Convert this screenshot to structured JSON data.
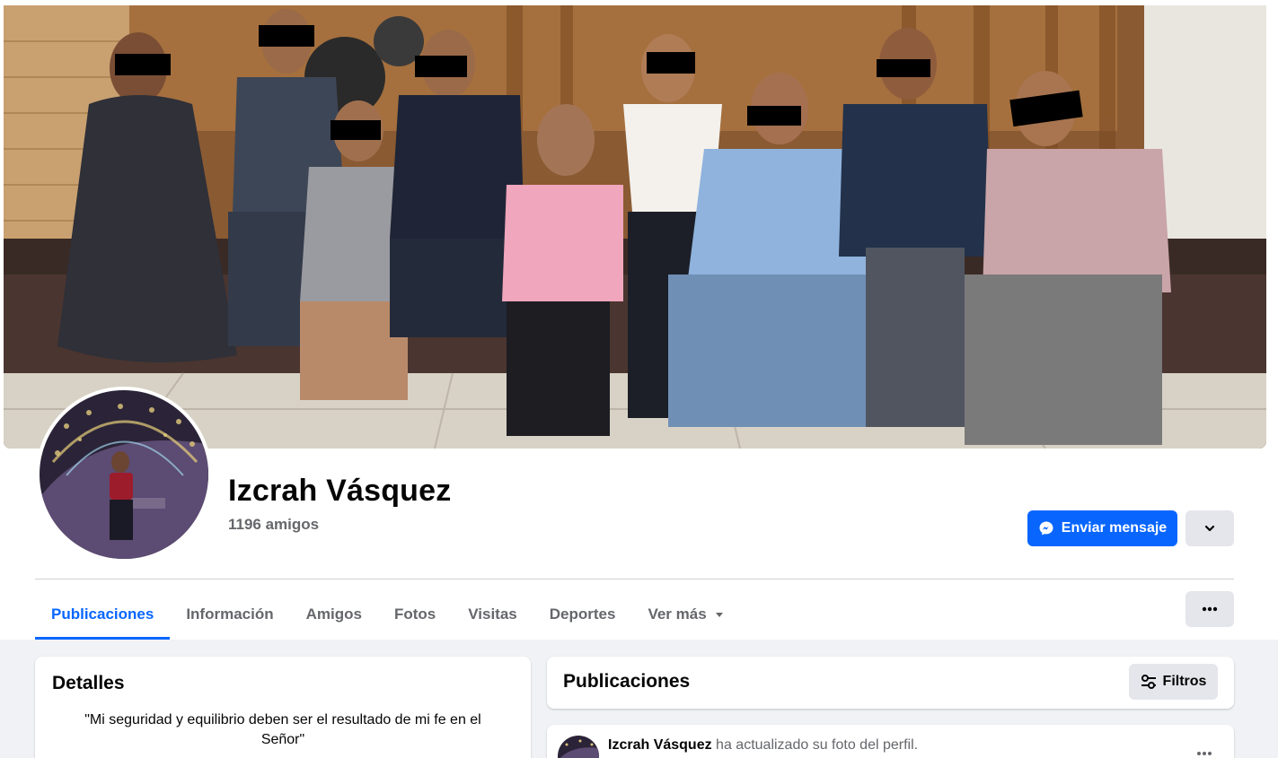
{
  "profile": {
    "name": "Izcrah Vásquez",
    "friends": "1196 amigos"
  },
  "actions": {
    "message_label": "Enviar mensaje",
    "message_icon": "messenger-icon",
    "dropdown_icon": "chevron-down-icon",
    "more_icon": "more-dots-icon"
  },
  "tabs": [
    {
      "label": "Publicaciones",
      "active": true
    },
    {
      "label": "Información"
    },
    {
      "label": "Amigos"
    },
    {
      "label": "Fotos"
    },
    {
      "label": "Visitas"
    },
    {
      "label": "Deportes"
    },
    {
      "label": "Ver más",
      "icon": "caret-down-icon"
    }
  ],
  "details": {
    "title": "Detalles",
    "bio": "\"Mi seguridad y equilibrio deben ser el resultado de mi fe en el Señor\""
  },
  "posts": {
    "title": "Publicaciones",
    "filters_label": "Filtros",
    "filters_icon": "sliders-icon",
    "first_post": {
      "author": "Izcrah Vásquez",
      "action": " ha actualizado su foto del perfil."
    }
  },
  "colors": {
    "accent": "#0866ff",
    "secondary_text": "#65676b",
    "button_gray": "#e4e6eb",
    "background": "#f0f2f5"
  }
}
